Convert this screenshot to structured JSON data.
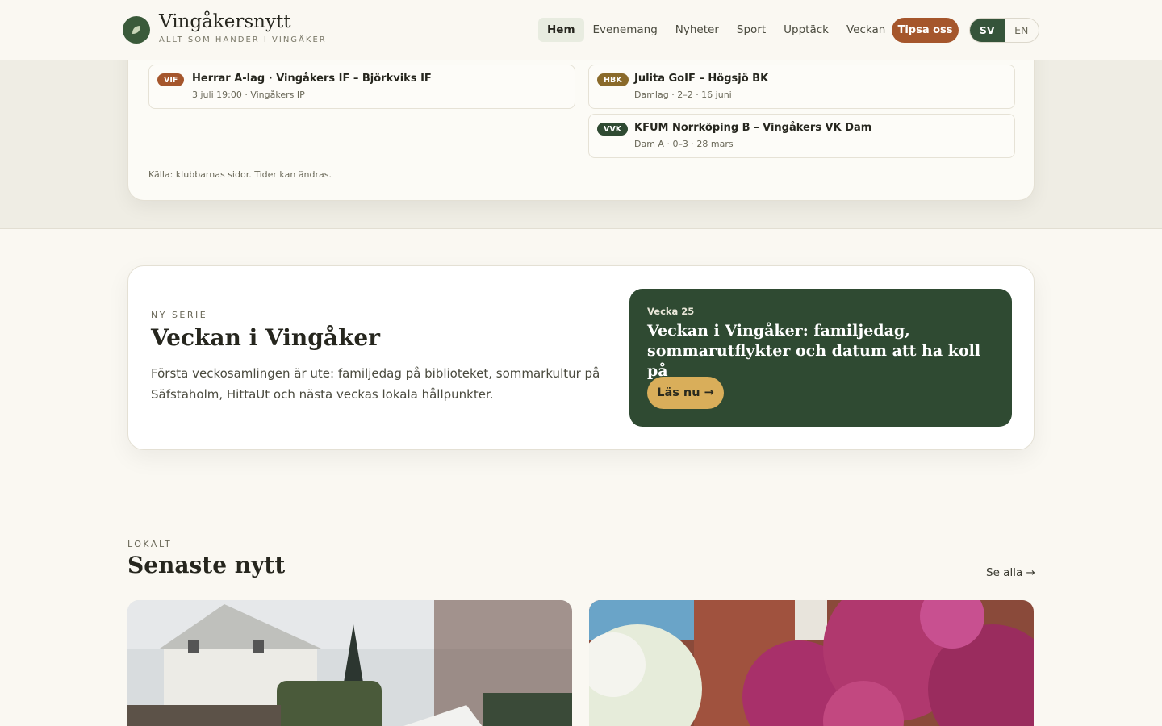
{
  "header": {
    "brand": "Vingåkersnytt",
    "tagline": "ALLT SOM HÄNDER I VINGÅKER",
    "nav": [
      "Hem",
      "Evenemang",
      "Nyheter",
      "Sport",
      "Upptäck",
      "Veckan"
    ],
    "active_nav": "Hem",
    "cta": "Tipsa oss",
    "lang_sv": "SV",
    "lang_en": "EN",
    "brand_color": "#35543a",
    "cta_color": "#a5562c"
  },
  "fixtures": {
    "matches": [
      {
        "badge": "VIF",
        "badge_color": "#a5562c",
        "title": "Herrar A-lag · Vingåkers IF – Björkviks IF",
        "meta": "3 juli 19:00 · Vingåkers IP"
      },
      {
        "badge": "HBK",
        "badge_color": "#8a6a2a",
        "title": "Julita GoIF – Högsjö BK",
        "meta": "Damlag · 2–2 · 16 juni"
      },
      {
        "badge": "VVK",
        "badge_color": "#2f4a32",
        "title": "KFUM Norrköping B – Vingåkers VK Dam",
        "meta": "Dam A · 0–3 · 28 mars"
      }
    ],
    "source": "Källa: klubbarnas sidor. Tider kan ändras."
  },
  "series": {
    "eyebrow": "NY SERIE",
    "title": "Veckan i Vingåker",
    "text": "Första veckosamlingen är ute: familjedag på biblioteket, sommarkultur på Säfstaholm, HittaUt och nästa veckas lokala hållpunkter.",
    "feature": {
      "week": "Vecka 25",
      "title": "Veckan i Vingåker: familjedag, sommarutflykter och datum att ha koll på",
      "button": "Läs nu →"
    }
  },
  "news": {
    "eyebrow": "LOKALT",
    "title": "Senaste nytt",
    "see_all": "Se alla →",
    "images": [
      "snowy-street-photo",
      "blossoming-trees-photo"
    ]
  }
}
